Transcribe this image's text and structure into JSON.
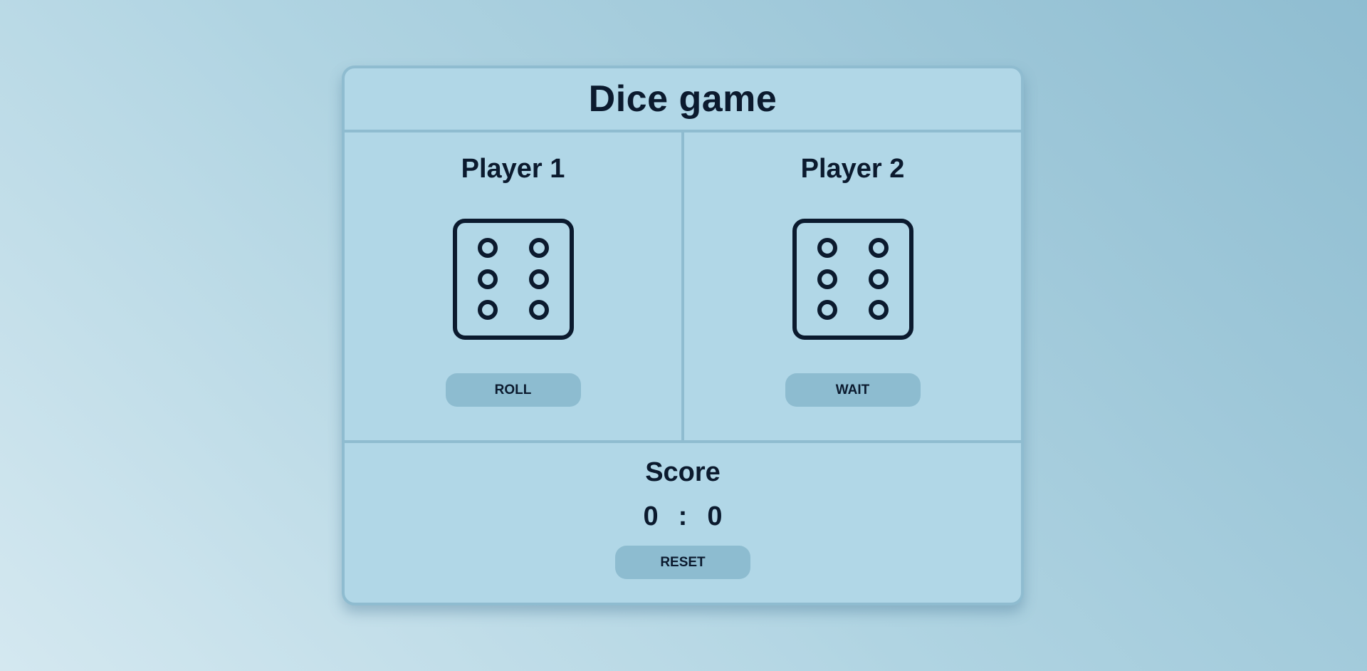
{
  "title": "Dice game",
  "players": [
    {
      "name": "Player 1",
      "die_value": 6,
      "die_icon": "dice-six-icon",
      "button_label": "ROLL"
    },
    {
      "name": "Player 2",
      "die_value": 6,
      "die_icon": "dice-six-icon",
      "button_label": "WAIT"
    }
  ],
  "score": {
    "title": "Score",
    "player1": "0",
    "separator": ":",
    "player2": "0",
    "reset_label": "RESET"
  },
  "colors": {
    "panel": "#b1d7e7",
    "border": "#8fbcd0",
    "button": "#8dbcd0",
    "text": "#0b1a2e"
  }
}
